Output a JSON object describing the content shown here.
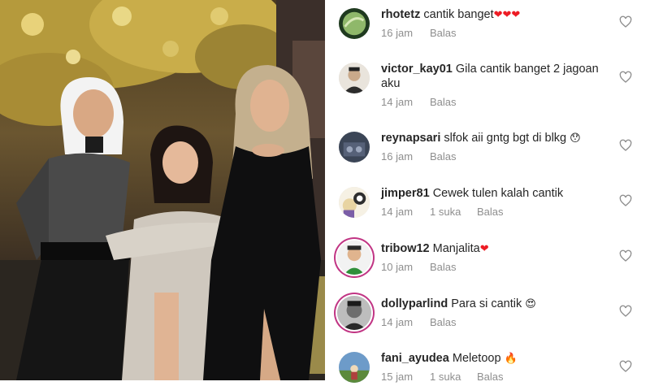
{
  "comments": [
    {
      "username": "rhotetz",
      "text": "cantik banget",
      "emoji": "❤❤❤",
      "time": "16 jam",
      "likes": "",
      "reply": "Balas",
      "avatar_color": "#8fb86a"
    },
    {
      "username": "victor_kay01",
      "text": "Gila cantik banget 2 jagoan aku",
      "emoji": "",
      "time": "14 jam",
      "likes": "",
      "reply": "Balas",
      "avatar_color": "#c9a98a"
    },
    {
      "username": "reynapsari",
      "text": "slfok aii gntg bgt di blkg",
      "emoji": "😯",
      "time": "16 jam",
      "likes": "",
      "reply": "Balas",
      "avatar_color": "#3b4556"
    },
    {
      "username": "jimper81",
      "text": "Cewek tulen kalah cantik",
      "emoji": "",
      "time": "14 jam",
      "likes": "1 suka",
      "reply": "Balas",
      "avatar_color": "#e8d4a2"
    },
    {
      "username": "tribow12",
      "text": "Manjalita",
      "emoji": "❤",
      "time": "10 jam",
      "likes": "",
      "reply": "Balas",
      "avatar_color": "#f2f2f2"
    },
    {
      "username": "dollyparlind",
      "text": "Para si cantik",
      "emoji": "😍",
      "time": "14 jam",
      "likes": "",
      "reply": "Balas",
      "avatar_color": "#444444"
    },
    {
      "username": "fani_ayudea",
      "text": "Meletoop",
      "emoji": "🔥",
      "time": "15 jam",
      "likes": "1 suka",
      "reply": "Balas",
      "avatar_color": "#6d9bc9"
    }
  ],
  "icons": {
    "like": "heart-outline-icon"
  },
  "colors": {
    "text": "#262626",
    "meta": "#8e8e8e",
    "heart": "#ed1c24"
  }
}
